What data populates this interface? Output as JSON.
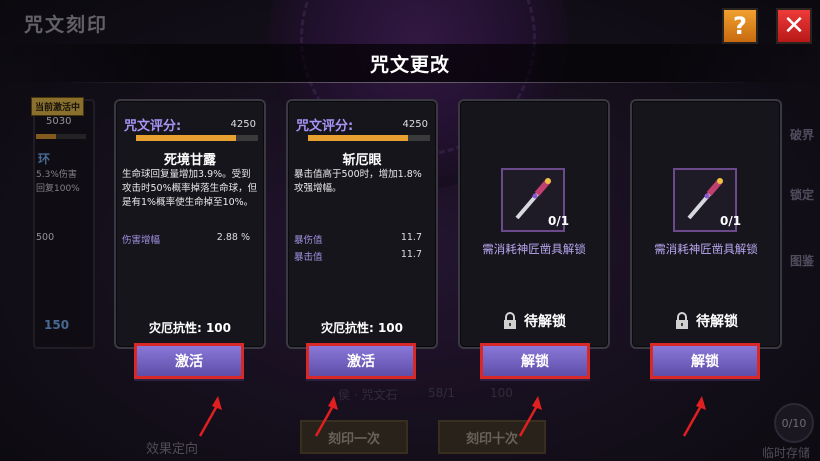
{
  "background": {
    "window_title": "咒文刻印",
    "stone_label": "侯 · 咒文石",
    "stone_count": "58/1",
    "coin_count": "100",
    "effect_direction_label": "效果定向",
    "engrave_once_label": "刻印一次",
    "engrave_ten_label": "刻印十次",
    "temp_storage_count": "0/10",
    "temp_storage_label": "临时存储",
    "right_side_labels": [
      "破界",
      "锁定",
      "图鉴"
    ]
  },
  "header": {
    "title": "咒文更改",
    "help_label": "?",
    "close_label": "✕"
  },
  "left_partial_card": {
    "badge": "当前激活中",
    "score": "5030",
    "score_fill": 0.4,
    "name": "环",
    "desc_lines": [
      "5.3%伤害",
      "回复100%"
    ],
    "stat_value": "500",
    "resistance_value": "150"
  },
  "cards": [
    {
      "rating_label": "咒文评分:",
      "rating_value": "4250",
      "rating_fill": 0.82,
      "name": "死境甘露",
      "description": "生命球回复量增加3.9%。受到攻击时50%概率掉落生命球，但是有1%概率使生命掉至10%。",
      "stats": [
        {
          "label": "伤害增幅",
          "value": "2.88 %"
        }
      ],
      "resistance": "灾厄抗性: 100",
      "button": "激活"
    },
    {
      "rating_label": "咒文评分:",
      "rating_value": "4250",
      "rating_fill": 0.82,
      "name": "斩厄眼",
      "description": "暴击值高于500时，增加1.8%攻强增幅。",
      "stats": [
        {
          "label": "暴伤值",
          "value": "11.7"
        },
        {
          "label": "暴击值",
          "value": "11.7"
        }
      ],
      "resistance": "灾厄抗性: 100",
      "button": "激活"
    },
    {
      "count": "0/1",
      "requirement": "需消耗神匠凿具解锁",
      "lock_status": "待解锁",
      "button": "解锁"
    },
    {
      "count": "0/1",
      "requirement": "需消耗神匠凿具解锁",
      "lock_status": "待解锁",
      "button": "解锁"
    }
  ],
  "colors": {
    "rating_text": "#a894f4",
    "rating_bar": "#e8a030",
    "button_fill": "#7262c2",
    "button_highlight_border": "#d82828",
    "arrow": "#e02020"
  },
  "icons": {
    "help": "question-icon",
    "close": "close-icon",
    "item": "chisel-icon",
    "lock": "lock-icon"
  }
}
